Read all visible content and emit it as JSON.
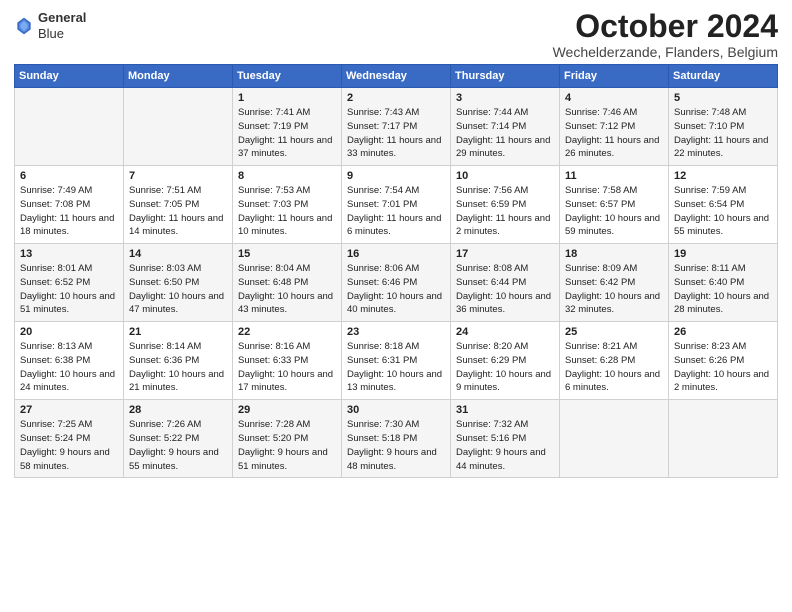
{
  "header": {
    "logo_line1": "General",
    "logo_line2": "Blue",
    "month_title": "October 2024",
    "subtitle": "Wechelderzande, Flanders, Belgium"
  },
  "days_of_week": [
    "Sunday",
    "Monday",
    "Tuesday",
    "Wednesday",
    "Thursday",
    "Friday",
    "Saturday"
  ],
  "weeks": [
    [
      {
        "day": "",
        "sunrise": "",
        "sunset": "",
        "daylight": ""
      },
      {
        "day": "",
        "sunrise": "",
        "sunset": "",
        "daylight": ""
      },
      {
        "day": "1",
        "sunrise": "Sunrise: 7:41 AM",
        "sunset": "Sunset: 7:19 PM",
        "daylight": "Daylight: 11 hours and 37 minutes."
      },
      {
        "day": "2",
        "sunrise": "Sunrise: 7:43 AM",
        "sunset": "Sunset: 7:17 PM",
        "daylight": "Daylight: 11 hours and 33 minutes."
      },
      {
        "day": "3",
        "sunrise": "Sunrise: 7:44 AM",
        "sunset": "Sunset: 7:14 PM",
        "daylight": "Daylight: 11 hours and 29 minutes."
      },
      {
        "day": "4",
        "sunrise": "Sunrise: 7:46 AM",
        "sunset": "Sunset: 7:12 PM",
        "daylight": "Daylight: 11 hours and 26 minutes."
      },
      {
        "day": "5",
        "sunrise": "Sunrise: 7:48 AM",
        "sunset": "Sunset: 7:10 PM",
        "daylight": "Daylight: 11 hours and 22 minutes."
      }
    ],
    [
      {
        "day": "6",
        "sunrise": "Sunrise: 7:49 AM",
        "sunset": "Sunset: 7:08 PM",
        "daylight": "Daylight: 11 hours and 18 minutes."
      },
      {
        "day": "7",
        "sunrise": "Sunrise: 7:51 AM",
        "sunset": "Sunset: 7:05 PM",
        "daylight": "Daylight: 11 hours and 14 minutes."
      },
      {
        "day": "8",
        "sunrise": "Sunrise: 7:53 AM",
        "sunset": "Sunset: 7:03 PM",
        "daylight": "Daylight: 11 hours and 10 minutes."
      },
      {
        "day": "9",
        "sunrise": "Sunrise: 7:54 AM",
        "sunset": "Sunset: 7:01 PM",
        "daylight": "Daylight: 11 hours and 6 minutes."
      },
      {
        "day": "10",
        "sunrise": "Sunrise: 7:56 AM",
        "sunset": "Sunset: 6:59 PM",
        "daylight": "Daylight: 11 hours and 2 minutes."
      },
      {
        "day": "11",
        "sunrise": "Sunrise: 7:58 AM",
        "sunset": "Sunset: 6:57 PM",
        "daylight": "Daylight: 10 hours and 59 minutes."
      },
      {
        "day": "12",
        "sunrise": "Sunrise: 7:59 AM",
        "sunset": "Sunset: 6:54 PM",
        "daylight": "Daylight: 10 hours and 55 minutes."
      }
    ],
    [
      {
        "day": "13",
        "sunrise": "Sunrise: 8:01 AM",
        "sunset": "Sunset: 6:52 PM",
        "daylight": "Daylight: 10 hours and 51 minutes."
      },
      {
        "day": "14",
        "sunrise": "Sunrise: 8:03 AM",
        "sunset": "Sunset: 6:50 PM",
        "daylight": "Daylight: 10 hours and 47 minutes."
      },
      {
        "day": "15",
        "sunrise": "Sunrise: 8:04 AM",
        "sunset": "Sunset: 6:48 PM",
        "daylight": "Daylight: 10 hours and 43 minutes."
      },
      {
        "day": "16",
        "sunrise": "Sunrise: 8:06 AM",
        "sunset": "Sunset: 6:46 PM",
        "daylight": "Daylight: 10 hours and 40 minutes."
      },
      {
        "day": "17",
        "sunrise": "Sunrise: 8:08 AM",
        "sunset": "Sunset: 6:44 PM",
        "daylight": "Daylight: 10 hours and 36 minutes."
      },
      {
        "day": "18",
        "sunrise": "Sunrise: 8:09 AM",
        "sunset": "Sunset: 6:42 PM",
        "daylight": "Daylight: 10 hours and 32 minutes."
      },
      {
        "day": "19",
        "sunrise": "Sunrise: 8:11 AM",
        "sunset": "Sunset: 6:40 PM",
        "daylight": "Daylight: 10 hours and 28 minutes."
      }
    ],
    [
      {
        "day": "20",
        "sunrise": "Sunrise: 8:13 AM",
        "sunset": "Sunset: 6:38 PM",
        "daylight": "Daylight: 10 hours and 24 minutes."
      },
      {
        "day": "21",
        "sunrise": "Sunrise: 8:14 AM",
        "sunset": "Sunset: 6:36 PM",
        "daylight": "Daylight: 10 hours and 21 minutes."
      },
      {
        "day": "22",
        "sunrise": "Sunrise: 8:16 AM",
        "sunset": "Sunset: 6:33 PM",
        "daylight": "Daylight: 10 hours and 17 minutes."
      },
      {
        "day": "23",
        "sunrise": "Sunrise: 8:18 AM",
        "sunset": "Sunset: 6:31 PM",
        "daylight": "Daylight: 10 hours and 13 minutes."
      },
      {
        "day": "24",
        "sunrise": "Sunrise: 8:20 AM",
        "sunset": "Sunset: 6:29 PM",
        "daylight": "Daylight: 10 hours and 9 minutes."
      },
      {
        "day": "25",
        "sunrise": "Sunrise: 8:21 AM",
        "sunset": "Sunset: 6:28 PM",
        "daylight": "Daylight: 10 hours and 6 minutes."
      },
      {
        "day": "26",
        "sunrise": "Sunrise: 8:23 AM",
        "sunset": "Sunset: 6:26 PM",
        "daylight": "Daylight: 10 hours and 2 minutes."
      }
    ],
    [
      {
        "day": "27",
        "sunrise": "Sunrise: 7:25 AM",
        "sunset": "Sunset: 5:24 PM",
        "daylight": "Daylight: 9 hours and 58 minutes."
      },
      {
        "day": "28",
        "sunrise": "Sunrise: 7:26 AM",
        "sunset": "Sunset: 5:22 PM",
        "daylight": "Daylight: 9 hours and 55 minutes."
      },
      {
        "day": "29",
        "sunrise": "Sunrise: 7:28 AM",
        "sunset": "Sunset: 5:20 PM",
        "daylight": "Daylight: 9 hours and 51 minutes."
      },
      {
        "day": "30",
        "sunrise": "Sunrise: 7:30 AM",
        "sunset": "Sunset: 5:18 PM",
        "daylight": "Daylight: 9 hours and 48 minutes."
      },
      {
        "day": "31",
        "sunrise": "Sunrise: 7:32 AM",
        "sunset": "Sunset: 5:16 PM",
        "daylight": "Daylight: 9 hours and 44 minutes."
      },
      {
        "day": "",
        "sunrise": "",
        "sunset": "",
        "daylight": ""
      },
      {
        "day": "",
        "sunrise": "",
        "sunset": "",
        "daylight": ""
      }
    ]
  ]
}
